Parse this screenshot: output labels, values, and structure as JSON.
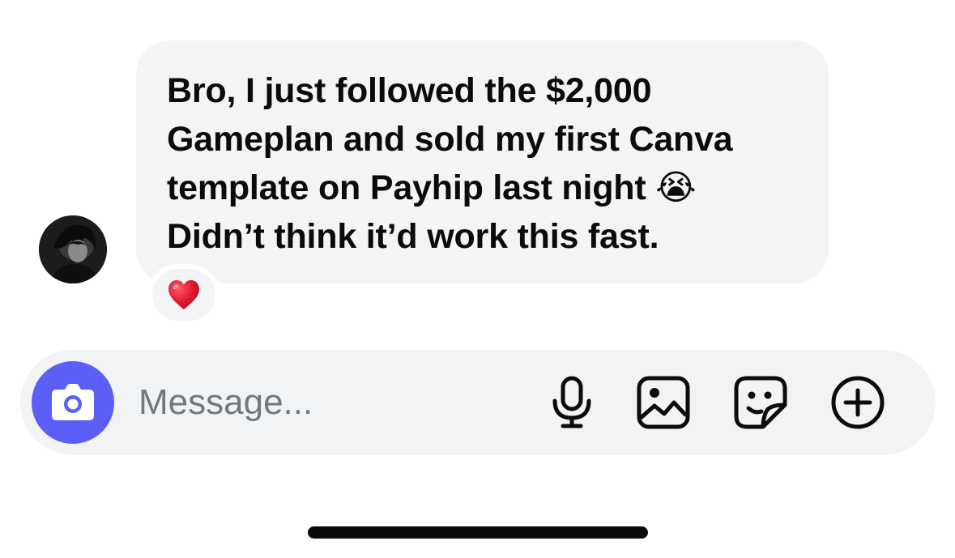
{
  "message": {
    "lines": [
      "Bro, I just followed the $2,000",
      "Gameplan and sold my first Canva",
      "template on Payhip last night 😭",
      "Didn’t think it’d work this fast."
    ],
    "reaction": "❤️",
    "sender_avatar_icon": "avatar-dark-character"
  },
  "composer": {
    "placeholder": "Message...",
    "camera_icon": "camera-icon",
    "actions": [
      "microphone-icon",
      "gallery-icon",
      "sticker-icon",
      "plus-icon"
    ]
  },
  "colors": {
    "bubble_bg": "#f3f4f6",
    "composer_bg": "#f2f3f5",
    "camera_accent": "#5b5ff5",
    "text": "#0b0b0b",
    "placeholder": "#737780",
    "heart": "#e0182d"
  }
}
